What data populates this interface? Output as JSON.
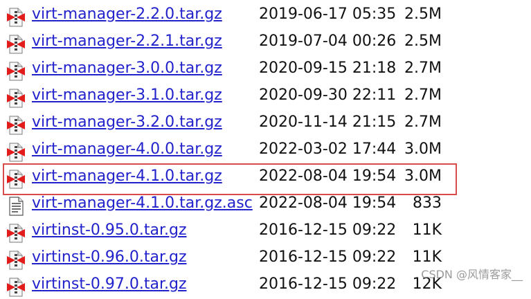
{
  "files": [
    {
      "name": "virt-manager-2.2.0.tar.gz",
      "date": "2019-06-17 05:35",
      "size": "2.5M",
      "icon": "compressed-file-icon"
    },
    {
      "name": "virt-manager-2.2.1.tar.gz",
      "date": "2019-07-04 00:26",
      "size": "2.5M",
      "icon": "compressed-file-icon"
    },
    {
      "name": "virt-manager-3.0.0.tar.gz",
      "date": "2020-09-15 21:18",
      "size": "2.7M",
      "icon": "compressed-file-icon"
    },
    {
      "name": "virt-manager-3.1.0.tar.gz",
      "date": "2020-09-30 22:11",
      "size": "2.7M",
      "icon": "compressed-file-icon"
    },
    {
      "name": "virt-manager-3.2.0.tar.gz",
      "date": "2020-11-14 21:15",
      "size": "2.7M",
      "icon": "compressed-file-icon"
    },
    {
      "name": "virt-manager-4.0.0.tar.gz",
      "date": "2022-03-02 17:44",
      "size": "3.0M",
      "icon": "compressed-file-icon"
    },
    {
      "name": "virt-manager-4.1.0.tar.gz",
      "date": "2022-08-04 19:54",
      "size": "3.0M",
      "icon": "compressed-file-icon",
      "highlighted": true
    },
    {
      "name": "virt-manager-4.1.0.tar.gz.asc",
      "date": "2022-08-04 19:54",
      "size": "833",
      "icon": "text-file-icon"
    },
    {
      "name": "virtinst-0.95.0.tar.gz",
      "date": "2016-12-15 09:22",
      "size": "11K",
      "icon": "compressed-file-icon"
    },
    {
      "name": "virtinst-0.96.0.tar.gz",
      "date": "2016-12-15 09:22",
      "size": "11K",
      "icon": "compressed-file-icon"
    },
    {
      "name": "virtinst-0.97.0.tar.gz",
      "date": "2016-12-15 09:22",
      "size": "12K",
      "icon": "compressed-file-icon"
    }
  ],
  "watermark": "CSDN @风情客家__",
  "colors": {
    "link": "#2222cc",
    "highlight_border": "#d94b4b",
    "icon_red": "#e21b1b"
  }
}
